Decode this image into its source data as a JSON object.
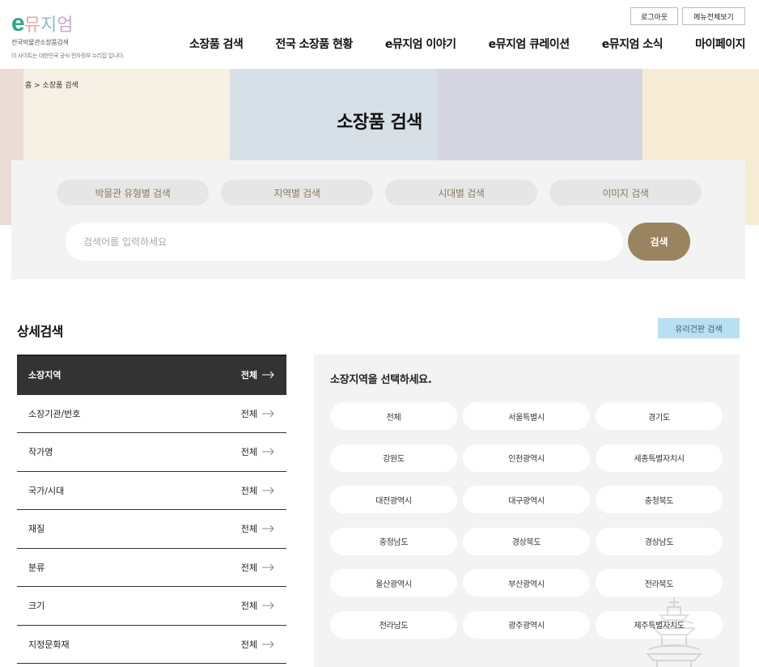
{
  "header": {
    "logo": {
      "mark_e": "e",
      "mark_word": [
        "뮤",
        "지",
        "엄"
      ],
      "mark_colors": [
        "#e9a6a6",
        "#8fb9d8",
        "#c4a7d6"
      ],
      "subtitle": "전국박물관소장품검색",
      "note": "이 사이트는 대한민국 공식 전자정부 누리집 입니다."
    },
    "util": {
      "logout": "로그아웃",
      "all_menu": "메뉴전체보기"
    },
    "nav": [
      "소장품 검색",
      "전국 소장품 현황",
      "e뮤지엄 이야기",
      "e뮤지엄 큐레이션",
      "e뮤지엄 소식",
      "마이페이지"
    ]
  },
  "banner": {
    "breadcrumb": "홈 > 소장품 검색",
    "title": "소장품 검색",
    "stripe_colors": [
      "#ecdcd6",
      "#f6f1e4",
      "#d8e0e7",
      "#d6d6e1",
      "#f6ecd6"
    ]
  },
  "search": {
    "tabs": [
      "박물관 유형별 검색",
      "지역별 검색",
      "시대별 검색",
      "이미지 검색"
    ],
    "placeholder": "검색어를 입력하세요",
    "button": "검색"
  },
  "detail": {
    "title": "상세검색",
    "glass_button": "유리건판 검색",
    "filters": [
      {
        "label": "소장지역",
        "value": "전체"
      },
      {
        "label": "소장기관/번호",
        "value": "전체"
      },
      {
        "label": "작가명",
        "value": "전체"
      },
      {
        "label": "국가/시대",
        "value": "전체"
      },
      {
        "label": "재질",
        "value": "전체"
      },
      {
        "label": "분류",
        "value": "전체"
      },
      {
        "label": "크기",
        "value": "전체"
      },
      {
        "label": "지정문화재",
        "value": "전체"
      }
    ],
    "region_prompt": "소장지역을 선택하세요.",
    "regions": [
      "전체",
      "서울특별시",
      "경기도",
      "강원도",
      "인천광역시",
      "세종특별자치시",
      "대전광역시",
      "대구광역시",
      "충청북도",
      "충청남도",
      "경상북도",
      "경상남도",
      "울산광역시",
      "부산광역시",
      "전라북도",
      "전라남도",
      "광주광역시",
      "제주특별자치도"
    ]
  },
  "colors": {
    "accent": "#9a8460",
    "active_filter": "#333333",
    "glass_button": "#b8e0f2",
    "logo_e": "#2aa58a"
  }
}
